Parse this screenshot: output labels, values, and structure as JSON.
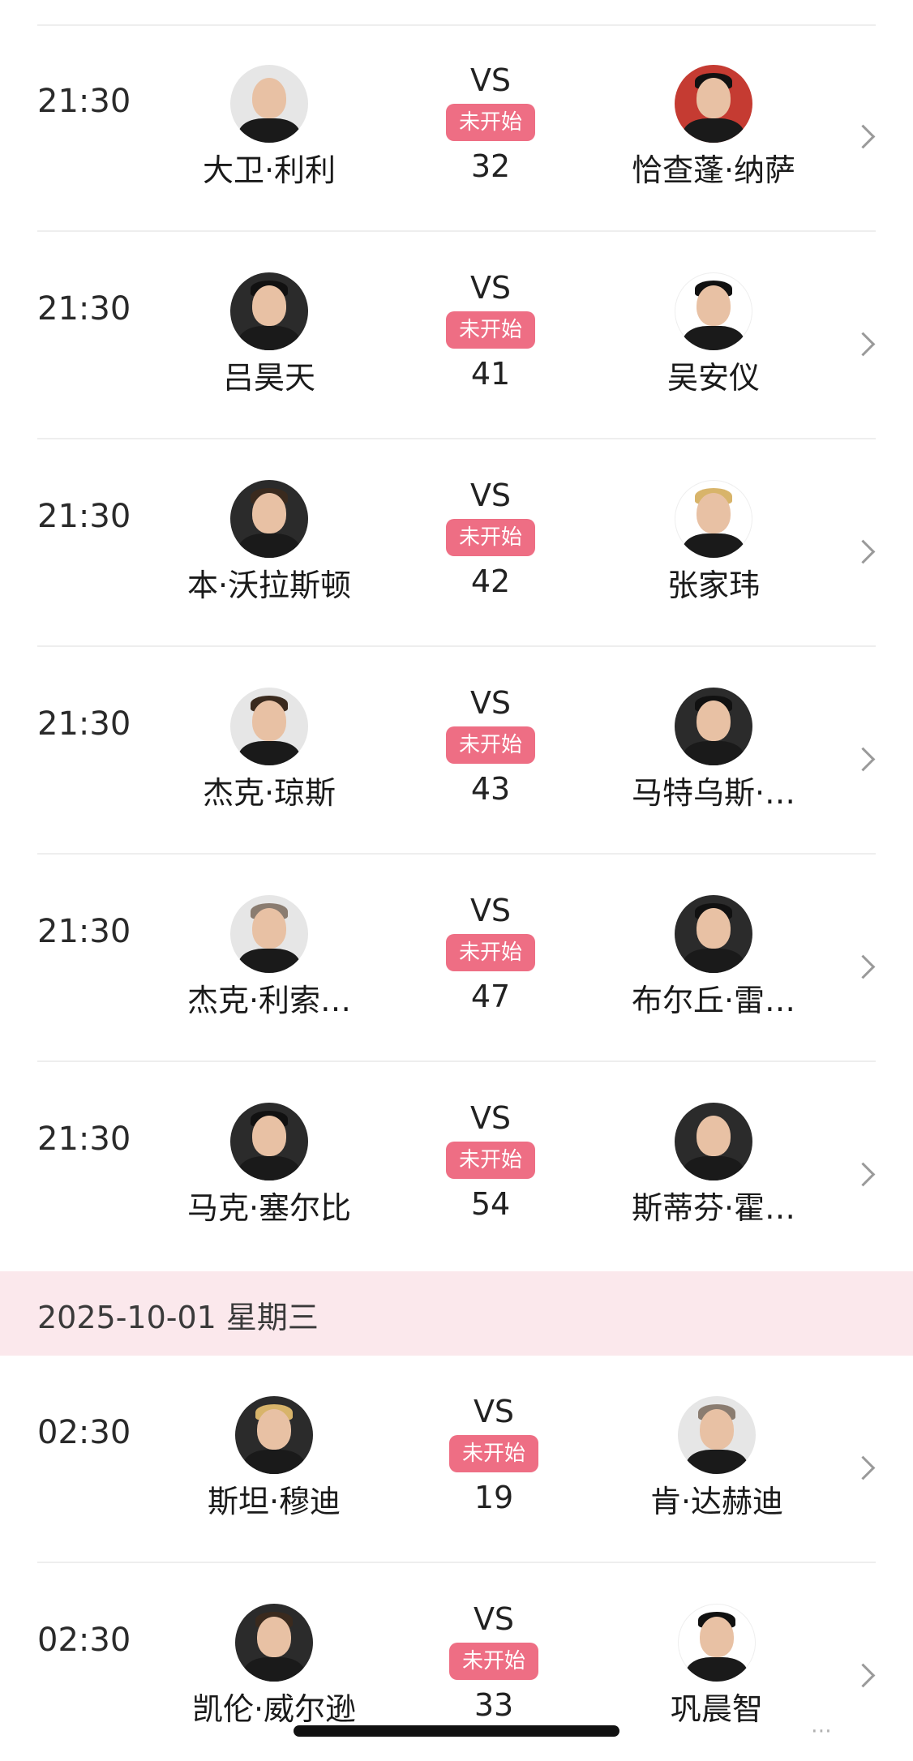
{
  "matches_day1": [
    {
      "time": "21:30",
      "home": {
        "name": "大卫·利利"
      },
      "vs": "VS",
      "status": "未开始",
      "number": "32",
      "away": {
        "name": "恰查蓬·纳萨"
      }
    },
    {
      "time": "21:30",
      "home": {
        "name": "吕昊天"
      },
      "vs": "VS",
      "status": "未开始",
      "number": "41",
      "away": {
        "name": "吴安仪"
      }
    },
    {
      "time": "21:30",
      "home": {
        "name": "本·沃拉斯顿"
      },
      "vs": "VS",
      "status": "未开始",
      "number": "42",
      "away": {
        "name": "张家玮"
      }
    },
    {
      "time": "21:30",
      "home": {
        "name": "杰克·琼斯"
      },
      "vs": "VS",
      "status": "未开始",
      "number": "43",
      "away": {
        "name": "马特乌斯·…"
      }
    },
    {
      "time": "21:30",
      "home": {
        "name": "杰克·利索…"
      },
      "vs": "VS",
      "status": "未开始",
      "number": "47",
      "away": {
        "name": "布尔丘·雷…"
      }
    },
    {
      "time": "21:30",
      "home": {
        "name": "马克·塞尔比"
      },
      "vs": "VS",
      "status": "未开始",
      "number": "54",
      "away": {
        "name": "斯蒂芬·霍…"
      }
    }
  ],
  "date_header": "2025-10-01 星期三",
  "matches_day2": [
    {
      "time": "02:30",
      "home": {
        "name": "斯坦·穆迪"
      },
      "vs": "VS",
      "status": "未开始",
      "number": "19",
      "away": {
        "name": "肯·达赫迪"
      }
    },
    {
      "time": "02:30",
      "home": {
        "name": "凯伦·威尔逊"
      },
      "vs": "VS",
      "status": "未开始",
      "number": "33",
      "away": {
        "name": "巩晨智"
      }
    }
  ],
  "watermark": "⋯",
  "colors": {
    "status_badge": "#ee6e84",
    "date_header_bg": "#fbe8ec",
    "divider": "#eeeeee"
  }
}
